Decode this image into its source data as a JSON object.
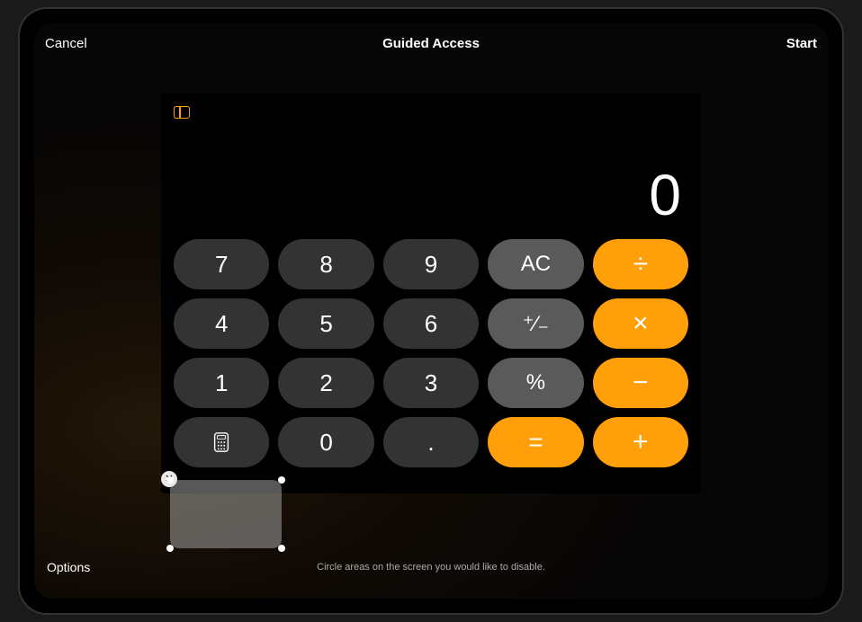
{
  "header": {
    "cancel": "Cancel",
    "title": "Guided Access",
    "start": "Start"
  },
  "calculator": {
    "display": "0",
    "keys": {
      "r1": [
        "7",
        "8",
        "9",
        "AC",
        "÷"
      ],
      "r2": [
        "4",
        "5",
        "6",
        "⁺⁄₋",
        "×"
      ],
      "r3": [
        "1",
        "2",
        "3",
        "%",
        "−"
      ],
      "r4_zero": "0",
      "r4_dot": ".",
      "r4_eq": "=",
      "r4_plus": "+"
    }
  },
  "footer": {
    "options": "Options",
    "hint": "Circle areas on the screen you would like to disable."
  },
  "disabled_region": {
    "close_symbol": "✕"
  }
}
